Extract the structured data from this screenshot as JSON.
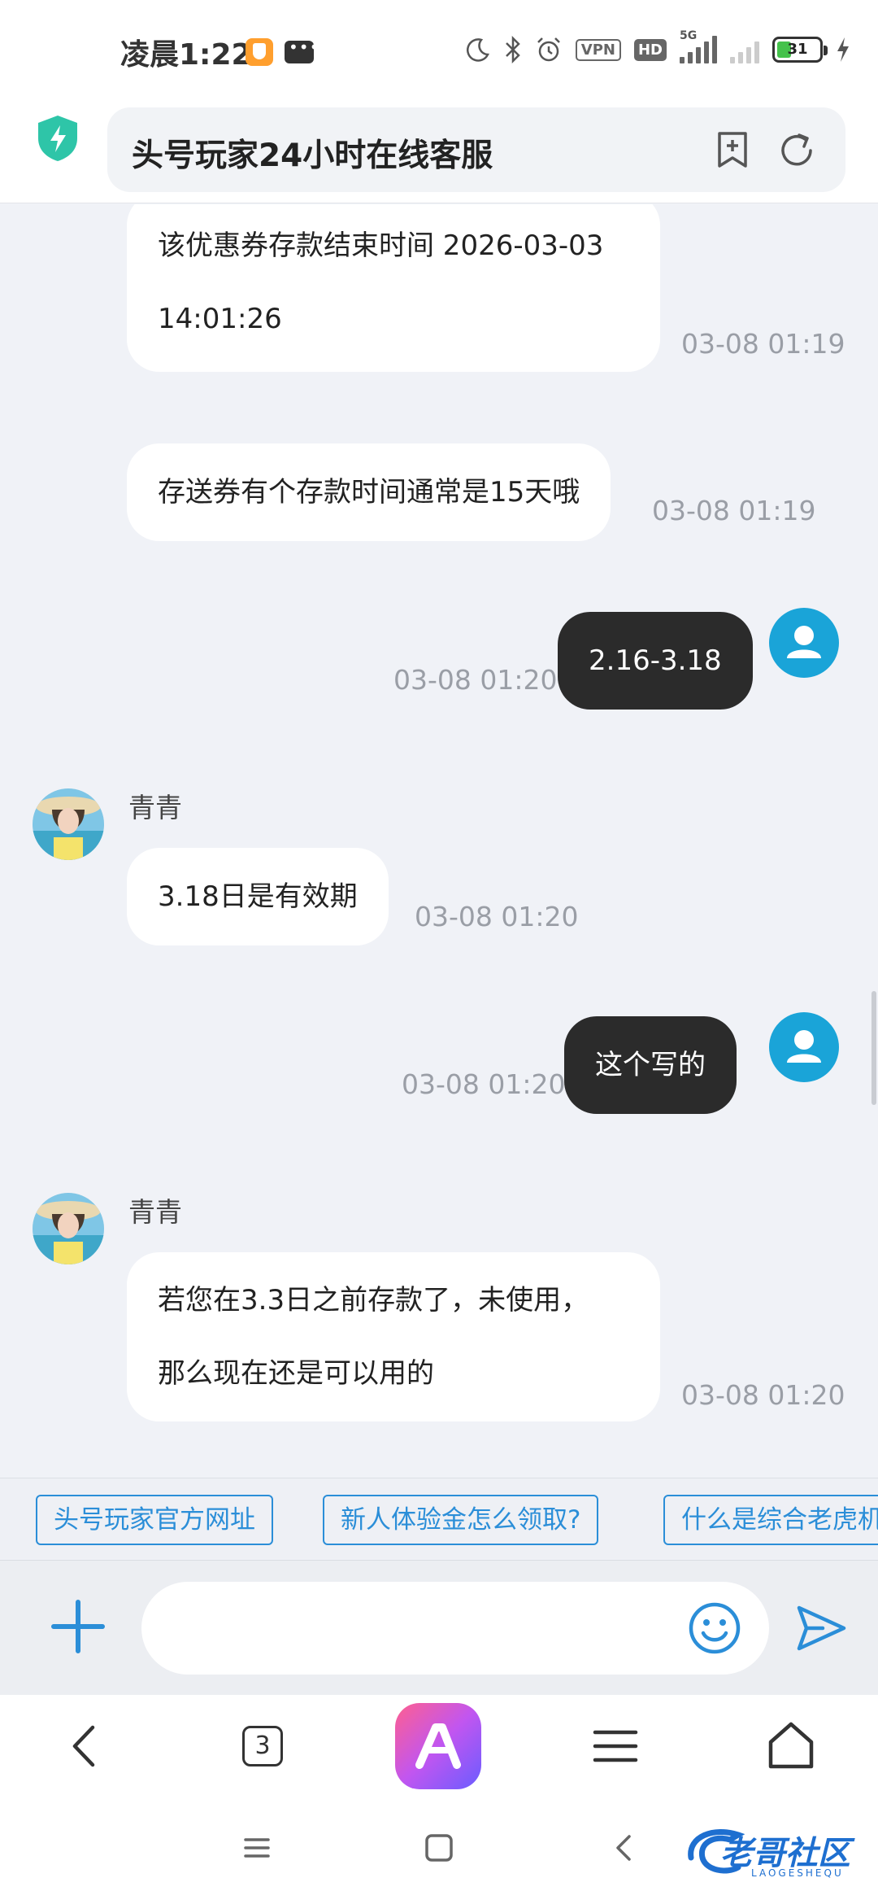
{
  "status_bar": {
    "time": "凌晨1:22",
    "vpn": "VPN",
    "hd": "HD",
    "network": "5G",
    "battery_level": "31",
    "icons": [
      "app-icon",
      "message-icon",
      "moon-icon",
      "bluetooth-icon",
      "alarm-icon",
      "vpn-icon",
      "hd-icon",
      "signal-icon",
      "signal-weak-icon",
      "battery-icon",
      "charging-icon"
    ]
  },
  "address_bar": {
    "title": "头号玩家24小时在线客服",
    "icons": [
      "shield-icon",
      "bookmark-add-icon",
      "refresh-icon"
    ]
  },
  "chat": {
    "messages": [
      {
        "side": "agent",
        "lines": [
          "该优惠券存款结束时间 2026-03-03",
          "14:01:26"
        ],
        "time": "03-08 01:19"
      },
      {
        "side": "agent",
        "lines": [
          "存送券有个存款时间通常是15天哦"
        ],
        "time": "03-08 01:19"
      },
      {
        "side": "user",
        "lines": [
          "2.16-3.18"
        ],
        "time": "03-08 01:20"
      },
      {
        "side": "agent",
        "name": "青青",
        "lines": [
          "3.18日是有效期"
        ],
        "time": "03-08 01:20"
      },
      {
        "side": "user",
        "lines": [
          "这个写的"
        ],
        "time": "03-08 01:20"
      },
      {
        "side": "agent",
        "name": "青青",
        "lines": [
          "若您在3.3日之前存款了，未使用，",
          "那么现在还是可以用的"
        ],
        "time": "03-08 01:20"
      }
    ]
  },
  "quick_replies": [
    "头号玩家官方网址",
    "新人体验金怎么领取?",
    "什么是综合老虎机"
  ],
  "input": {
    "value": "",
    "placeholder": ""
  },
  "browser_bar": {
    "tab_count": "3",
    "icons": [
      "back-icon",
      "tabs-icon",
      "app-logo-icon",
      "menu-icon",
      "home-icon"
    ]
  },
  "system_nav": {
    "icons": [
      "recent-apps-icon",
      "home-square-icon",
      "system-back-icon"
    ],
    "watermark": "老哥社区",
    "watermark_sub": "LAOGESHEQU"
  },
  "colors": {
    "accent": "#2b8ed8",
    "user_bubble": "#2b2b2b",
    "agent_bubble": "#ffffff",
    "chat_bg": "#f0f2f7",
    "user_avatar": "#1aa4d8",
    "shield": "#2ec5a8"
  }
}
